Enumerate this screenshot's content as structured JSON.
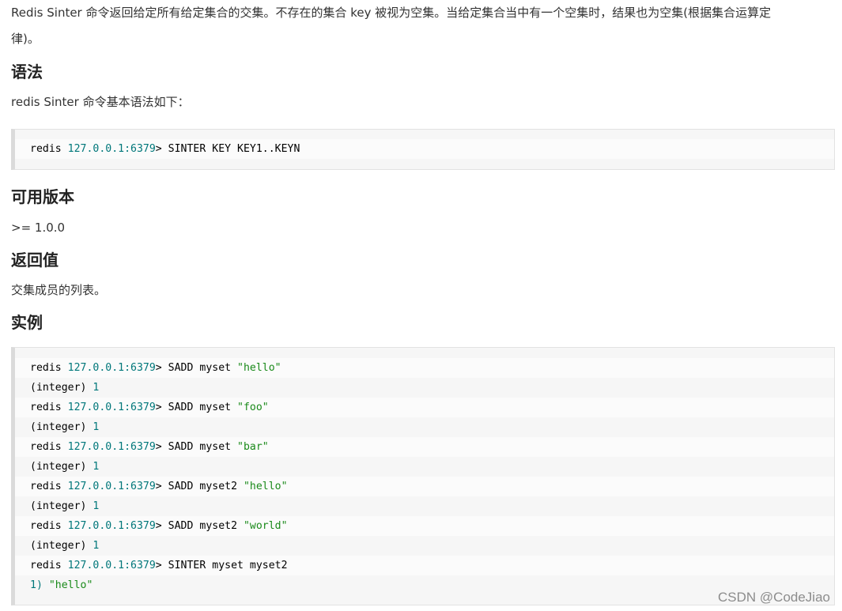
{
  "intro": {
    "line1": "Redis Sinter 命令返回给定所有给定集合的交集。不存在的集合 key 被视为空集。当给定集合当中有一个空集时，结果也为空集(根据集合运算定",
    "line2": "律)。"
  },
  "syntax": {
    "heading": "语法",
    "desc": "redis Sinter 命令基本语法如下：",
    "code": {
      "prefix": "redis ",
      "ip": "127.0.0.1:6379",
      "rest": "> SINTER KEY KEY1..KEYN"
    }
  },
  "version": {
    "heading": "可用版本",
    "value": ">= 1.0.0"
  },
  "return_value": {
    "heading": "返回值",
    "desc": "交集成员的列表。"
  },
  "example": {
    "heading": "实例",
    "lines": [
      {
        "prefix": "redis ",
        "ip": "127.0.0.1:6379",
        "cmd": "> SADD myset ",
        "str": "\"hello\""
      },
      {
        "label": "(integer) ",
        "num": "1"
      },
      {
        "prefix": "redis ",
        "ip": "127.0.0.1:6379",
        "cmd": "> SADD myset ",
        "str": "\"foo\""
      },
      {
        "label": "(integer) ",
        "num": "1"
      },
      {
        "prefix": "redis ",
        "ip": "127.0.0.1:6379",
        "cmd": "> SADD myset ",
        "str": "\"bar\""
      },
      {
        "label": "(integer) ",
        "num": "1"
      },
      {
        "prefix": "redis ",
        "ip": "127.0.0.1:6379",
        "cmd": "> SADD myset2 ",
        "str": "\"hello\""
      },
      {
        "label": "(integer) ",
        "num": "1"
      },
      {
        "prefix": "redis ",
        "ip": "127.0.0.1:6379",
        "cmd": "> SADD myset2 ",
        "str": "\"world\""
      },
      {
        "label": "(integer) ",
        "num": "1"
      },
      {
        "prefix": "redis ",
        "ip": "127.0.0.1:6379",
        "cmd": "> SINTER myset myset2",
        "str": ""
      },
      {
        "num": "1) ",
        "str": "\"hello\""
      }
    ]
  },
  "watermark": "CSDN @CodeJiao",
  "colors": {
    "ip": "#00777a",
    "string": "#1a8a1a",
    "text": "#333333"
  }
}
